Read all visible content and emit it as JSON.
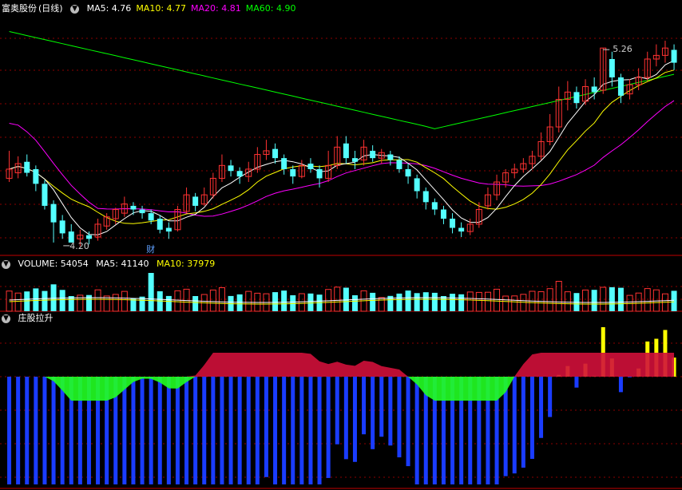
{
  "header": {
    "stock_name": "富奥股份",
    "period": "(日线)",
    "ma_items": [
      {
        "label": "MA5: 4.76",
        "color": "#ffffff"
      },
      {
        "label": "MA10: 4.77",
        "color": "#ffff00"
      },
      {
        "label": "MA20: 4.81",
        "color": "#ff00ff"
      },
      {
        "label": "MA60: 4.90",
        "color": "#00ff00"
      }
    ]
  },
  "volume_header": {
    "label": "VOLUME: 54054",
    "ma5": "MA5: 41140",
    "ma10": "MA10: 37979"
  },
  "indicator_header": {
    "label": "庄股拉升"
  },
  "annotations": {
    "high": "5.26",
    "low": "4.20",
    "event": "财"
  },
  "colors": {
    "up": "#ff3232",
    "down": "#54ffff",
    "ma5": "#ffffff",
    "ma10": "#ffff00",
    "ma20": "#ff00ff",
    "ma60": "#00ff00",
    "grid": "#8b0000",
    "ind_yellow": "#ffff00",
    "ind_blue": "#1a3cff",
    "ind_red": "#d0103a",
    "ind_green": "#22ff22"
  },
  "chart_data": {
    "type": "candlestick",
    "price_range": [
      4.13,
      5.4
    ],
    "candles": [
      [
        4.55,
        4.6,
        4.7,
        4.53
      ],
      [
        4.58,
        4.63,
        4.67,
        4.55
      ],
      [
        4.64,
        4.58,
        4.68,
        4.56
      ],
      [
        4.6,
        4.52,
        4.62,
        4.48
      ],
      [
        4.52,
        4.4,
        4.54,
        4.38
      ],
      [
        4.41,
        4.31,
        4.43,
        4.2
      ],
      [
        4.32,
        4.25,
        4.35,
        4.22
      ],
      [
        4.26,
        4.2,
        4.3,
        4.2
      ],
      [
        4.22,
        4.24,
        4.27,
        4.18
      ],
      [
        4.24,
        4.22,
        4.26,
        4.19
      ],
      [
        4.23,
        4.3,
        4.33,
        4.21
      ],
      [
        4.29,
        4.34,
        4.36,
        4.27
      ],
      [
        4.33,
        4.38,
        4.39,
        4.3
      ],
      [
        4.36,
        4.41,
        4.45,
        4.34
      ],
      [
        4.4,
        4.38,
        4.42,
        4.35
      ],
      [
        4.38,
        4.36,
        4.4,
        4.33
      ],
      [
        4.36,
        4.32,
        4.38,
        4.3
      ],
      [
        4.33,
        4.27,
        4.35,
        4.25
      ],
      [
        4.28,
        4.26,
        4.31,
        4.22
      ],
      [
        4.27,
        4.38,
        4.4,
        4.26
      ],
      [
        4.37,
        4.46,
        4.5,
        4.36
      ],
      [
        4.45,
        4.4,
        4.47,
        4.37
      ],
      [
        4.41,
        4.46,
        4.5,
        4.4
      ],
      [
        4.46,
        4.55,
        4.58,
        4.44
      ],
      [
        4.55,
        4.62,
        4.68,
        4.53
      ],
      [
        4.62,
        4.59,
        4.65,
        4.56
      ],
      [
        4.59,
        4.56,
        4.61,
        4.52
      ],
      [
        4.56,
        4.6,
        4.64,
        4.53
      ],
      [
        4.6,
        4.68,
        4.72,
        4.58
      ],
      [
        4.68,
        4.7,
        4.76,
        4.65
      ],
      [
        4.71,
        4.66,
        4.74,
        4.63
      ],
      [
        4.66,
        4.6,
        4.68,
        4.57
      ],
      [
        4.6,
        4.56,
        4.62,
        4.52
      ],
      [
        4.56,
        4.62,
        4.65,
        4.55
      ],
      [
        4.63,
        4.6,
        4.66,
        4.58
      ],
      [
        4.6,
        4.55,
        4.62,
        4.5
      ],
      [
        4.55,
        4.62,
        4.7,
        4.53
      ],
      [
        4.62,
        4.72,
        4.78,
        4.6
      ],
      [
        4.74,
        4.66,
        4.78,
        4.63
      ],
      [
        4.66,
        4.64,
        4.7,
        4.6
      ],
      [
        4.65,
        4.72,
        4.76,
        4.62
      ],
      [
        4.7,
        4.66,
        4.73,
        4.64
      ],
      [
        4.66,
        4.69,
        4.71,
        4.63
      ],
      [
        4.68,
        4.65,
        4.7,
        4.62
      ],
      [
        4.65,
        4.6,
        4.67,
        4.58
      ],
      [
        4.6,
        4.56,
        4.63,
        4.52
      ],
      [
        4.55,
        4.48,
        4.57,
        4.44
      ],
      [
        4.48,
        4.42,
        4.5,
        4.38
      ],
      [
        4.42,
        4.38,
        4.44,
        4.35
      ],
      [
        4.38,
        4.33,
        4.4,
        4.3
      ],
      [
        4.33,
        4.28,
        4.36,
        4.25
      ],
      [
        4.28,
        4.26,
        4.31,
        4.23
      ],
      [
        4.26,
        4.3,
        4.33,
        4.24
      ],
      [
        4.3,
        4.38,
        4.42,
        4.28
      ],
      [
        4.4,
        4.46,
        4.5,
        4.38
      ],
      [
        4.46,
        4.53,
        4.57,
        4.43
      ],
      [
        4.53,
        4.58,
        4.6,
        4.5
      ],
      [
        4.58,
        4.6,
        4.63,
        4.55
      ],
      [
        4.6,
        4.63,
        4.66,
        4.58
      ],
      [
        4.63,
        4.67,
        4.7,
        4.6
      ],
      [
        4.67,
        4.75,
        4.8,
        4.65
      ],
      [
        4.75,
        4.83,
        4.9,
        4.73
      ],
      [
        4.83,
        4.98,
        5.05,
        4.8
      ],
      [
        4.98,
        5.02,
        5.08,
        4.92
      ],
      [
        5.02,
        4.96,
        5.05,
        4.93
      ],
      [
        4.97,
        5.05,
        5.09,
        4.95
      ],
      [
        5.05,
        5.02,
        5.1,
        4.98
      ],
      [
        5.03,
        5.26,
        5.26,
        5.01
      ],
      [
        5.2,
        5.1,
        5.24,
        5.05
      ],
      [
        5.1,
        5.0,
        5.12,
        4.96
      ],
      [
        5.01,
        5.06,
        5.09,
        4.98
      ],
      [
        5.06,
        5.1,
        5.15,
        5.03
      ],
      [
        5.1,
        5.2,
        5.24,
        5.08
      ],
      [
        5.2,
        5.22,
        5.28,
        5.16
      ],
      [
        5.22,
        5.26,
        5.3,
        5.18
      ],
      [
        5.25,
        5.18,
        5.28,
        5.14
      ]
    ]
  }
}
